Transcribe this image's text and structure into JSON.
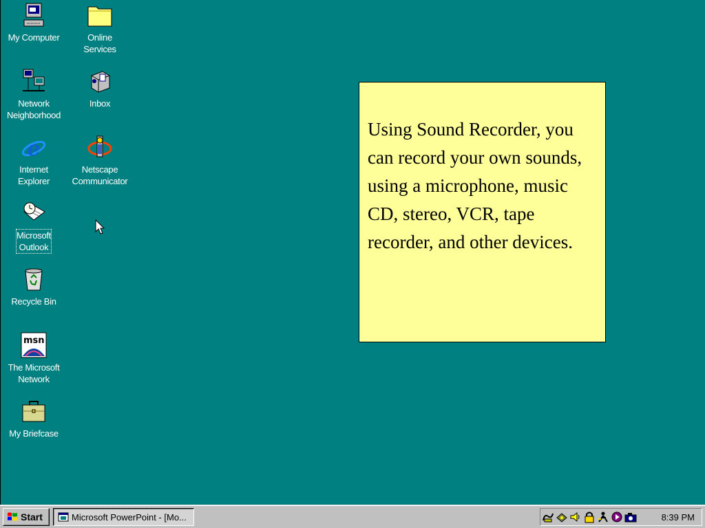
{
  "desktop": {
    "icons": [
      {
        "label": "My Computer"
      },
      {
        "label": "Online\nServices"
      },
      {
        "label": "Network\nNeighborhood"
      },
      {
        "label": "Inbox"
      },
      {
        "label": "Internet\nExplorer"
      },
      {
        "label": "Netscape\nCommunicator"
      },
      {
        "label": "Microsoft\nOutlook"
      },
      {
        "label": "Recycle Bin"
      },
      {
        "label": "The Microsoft\nNetwork"
      },
      {
        "label": "My Briefcase"
      }
    ]
  },
  "note": {
    "text": "Using Sound Recorder, you can record your own sounds, using a microphone, music CD, stereo, VCR, tape recorder, and other devices."
  },
  "taskbar": {
    "start_label": "Start",
    "tasks": [
      {
        "label": "Microsoft PowerPoint - [Mo..."
      }
    ],
    "tray_icons": [
      "modem-icon",
      "satellite-icon",
      "volume-icon",
      "lock-icon",
      "scheduler-icon",
      "realplayer-icon",
      "camera-icon"
    ],
    "clock": "8:39 PM"
  },
  "colors": {
    "desktop": "#008080",
    "note_background": "#ffff99",
    "taskbar": "#c0c0c0"
  }
}
